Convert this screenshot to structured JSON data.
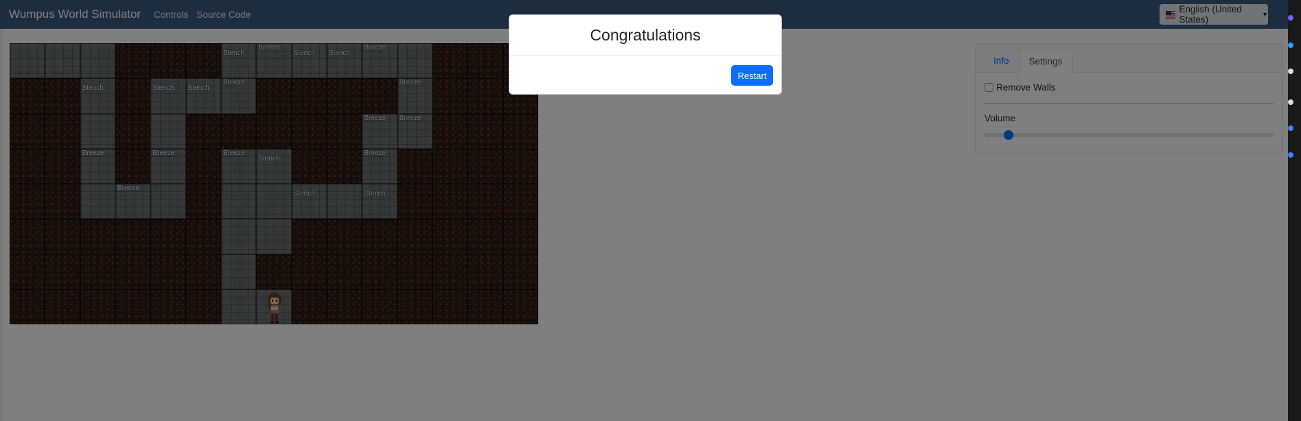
{
  "navbar": {
    "brand": "Wumpus World Simulator",
    "links": [
      "Controls",
      "Source Code"
    ],
    "language": "English (United States)",
    "background_color": "#3a5a80"
  },
  "board": {
    "columns": 15,
    "rows": 8,
    "layout": [
      "FFFRRRFFFFFFRRR",
      "RRFRFFFRRRRFRRR",
      "RRFRFRRRRRFFRRR",
      "RRFRFRFFRRFRRRR",
      "RRFFFRFFFFFRRRR",
      "RRRRRRFFRRRRRRR",
      "RRRRRRFRRRRRRRR",
      "RRRRRRFFRRRRRRR"
    ],
    "percepts": [
      {
        "row": 0,
        "col": 6,
        "text": "Stench",
        "pos": "mid"
      },
      {
        "row": 0,
        "col": 7,
        "text": "Breeze",
        "pos": "top"
      },
      {
        "row": 0,
        "col": 8,
        "text": "Stench",
        "pos": "mid"
      },
      {
        "row": 0,
        "col": 9,
        "text": "Stench",
        "pos": "mid"
      },
      {
        "row": 0,
        "col": 10,
        "text": "Breeze",
        "pos": "top"
      },
      {
        "row": 1,
        "col": 2,
        "text": "Stench",
        "pos": "mid"
      },
      {
        "row": 1,
        "col": 4,
        "text": "Stench",
        "pos": "mid"
      },
      {
        "row": 1,
        "col": 5,
        "text": "Stench",
        "pos": "mid"
      },
      {
        "row": 1,
        "col": 6,
        "text": "Breeze",
        "pos": "top"
      },
      {
        "row": 1,
        "col": 11,
        "text": "Breeze",
        "pos": "top"
      },
      {
        "row": 2,
        "col": 10,
        "text": "Breeze",
        "pos": "top"
      },
      {
        "row": 2,
        "col": 11,
        "text": "Breeze",
        "pos": "top"
      },
      {
        "row": 3,
        "col": 2,
        "text": "Breeze",
        "pos": "top"
      },
      {
        "row": 3,
        "col": 4,
        "text": "Breeze",
        "pos": "top"
      },
      {
        "row": 3,
        "col": 6,
        "text": "Breeze",
        "pos": "top"
      },
      {
        "row": 3,
        "col": 7,
        "text": "Stench",
        "pos": "mid"
      },
      {
        "row": 3,
        "col": 10,
        "text": "Breeze",
        "pos": "top"
      },
      {
        "row": 4,
        "col": 3,
        "text": "Breeze",
        "pos": "top"
      },
      {
        "row": 4,
        "col": 8,
        "text": "Stench",
        "pos": "mid"
      },
      {
        "row": 4,
        "col": 10,
        "text": "Stench",
        "pos": "mid"
      }
    ],
    "agent": {
      "row": 7,
      "col": 7
    }
  },
  "side_panel": {
    "tabs": [
      {
        "label": "Info",
        "active": false
      },
      {
        "label": "Settings",
        "active": true
      }
    ],
    "remove_walls_label": "Remove Walls",
    "remove_walls_checked": false,
    "volume_label": "Volume",
    "volume_fraction": 0.07
  },
  "modal": {
    "title": "Congratulations",
    "restart_label": "Restart"
  }
}
